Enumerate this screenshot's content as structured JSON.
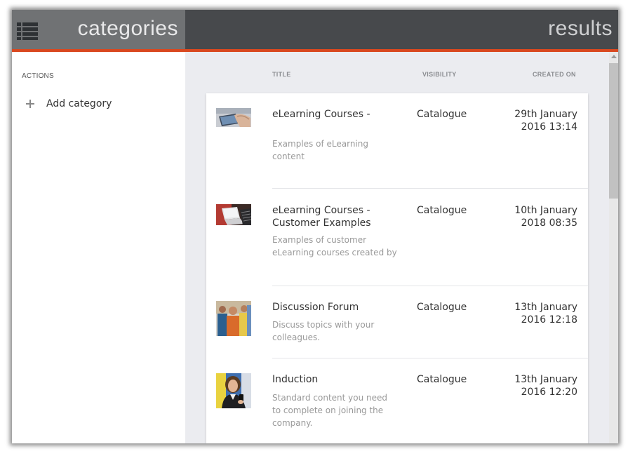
{
  "header": {
    "categories_title": "categories",
    "results_title": "results",
    "accent_color": "#d9481f"
  },
  "sidebar": {
    "actions_label": "ACTIONS",
    "add_category_label": "Add category"
  },
  "columns": {
    "title": "TITLE",
    "visibility": "VISIBILITY",
    "created_on": "CREATED ON"
  },
  "results": [
    {
      "title_lines": [
        "eLearning Courses -"
      ],
      "description_lines": [
        "Examples of eLearning",
        "content"
      ],
      "visibility": "Catalogue",
      "date_lines": [
        "29th January",
        "2016 13:14"
      ],
      "thumbnail": "tablet-hand-thumbnail"
    },
    {
      "title_lines": [
        "eLearning Courses -",
        "Customer Examples"
      ],
      "description_lines": [
        "Examples of customer",
        "eLearning courses created by"
      ],
      "visibility": "Catalogue",
      "date_lines": [
        "10th January",
        "2018 08:35"
      ],
      "thumbnail": "laptop-thumbnail"
    },
    {
      "title_lines": [
        "Discussion Forum"
      ],
      "description_lines": [
        "Discuss topics with your",
        "colleagues."
      ],
      "visibility": "Catalogue",
      "date_lines": [
        "13th January",
        "2016 12:18"
      ],
      "thumbnail": "people-group-thumbnail"
    },
    {
      "title_lines": [
        "Induction"
      ],
      "description_lines": [
        "Standard content you need",
        "to complete on joining the",
        "company."
      ],
      "visibility": "Catalogue",
      "date_lines": [
        "13th January",
        "2016 12:20"
      ],
      "thumbnail": "woman-phone-thumbnail"
    }
  ]
}
